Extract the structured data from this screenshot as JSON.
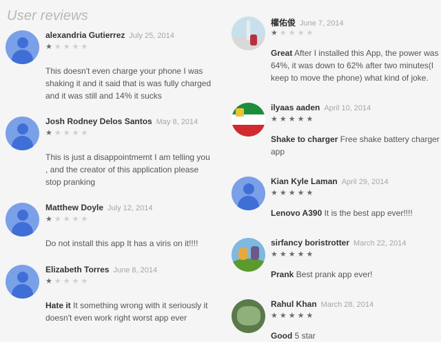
{
  "page": {
    "title": "User reviews"
  },
  "left_reviews": [
    {
      "author": "alexandria Gutierrez",
      "date": "July 25, 2014",
      "rating": 1,
      "lead": "",
      "body": "This doesn't even charge your phone I was shaking it and it said that is was fully charged and it was still and 14% it sucks",
      "avatar": "default-avatar-icon"
    },
    {
      "author": "Josh Rodney Delos Santos",
      "date": "May 8, 2014",
      "rating": 1,
      "lead": "",
      "body": "This is just a disappointmemt I am telling you , and the creator of this application please stop pranking",
      "avatar": "default-avatar-icon"
    },
    {
      "author": "Matthew Doyle",
      "date": "July 12, 2014",
      "rating": 1,
      "lead": "",
      "body": "Do not install this app It has a viris on it!!!!",
      "avatar": "default-avatar-icon"
    },
    {
      "author": "Elizabeth Torres",
      "date": "June 8, 2014",
      "rating": 1,
      "lead": "Hate it",
      "body": "It something wrong with it seriously it doesn't even work right worst app ever",
      "avatar": "default-avatar-icon"
    }
  ],
  "right_reviews": [
    {
      "author": "權佑俊",
      "date": "June 7, 2014",
      "rating": 1,
      "lead": "Great",
      "body": "After I installed this App, the power was 64%, it was down to 62% after two minutes(I keep to move the phone) what kind of joke.",
      "avatar": "monument-photo-avatar"
    },
    {
      "author": "ilyaas aaden",
      "date": "April 10, 2014",
      "rating": 5,
      "lead": "Shake to charger",
      "body": "Free shake battery charger app",
      "avatar": "flag-avatar"
    },
    {
      "author": "Kian Kyle Laman",
      "date": "April 29, 2014",
      "rating": 5,
      "lead": "Lenovo A390",
      "body": "It is the best app ever!!!!",
      "avatar": "default-avatar-icon"
    },
    {
      "author": "sirfancy boristrotter",
      "date": "March 22, 2014",
      "rating": 5,
      "lead": "Prank",
      "body": "Best prank app ever!",
      "avatar": "cartoon-avatar"
    },
    {
      "author": "Rahul Khan",
      "date": "March 28, 2014",
      "rating": 5,
      "lead": "Good",
      "body": "5 star",
      "avatar": "green-photo-avatar"
    }
  ],
  "colors": {
    "star_on": "#6b6b6b",
    "star_off": "#cfcfcf",
    "avatar_blue": "#7aa0e8"
  }
}
